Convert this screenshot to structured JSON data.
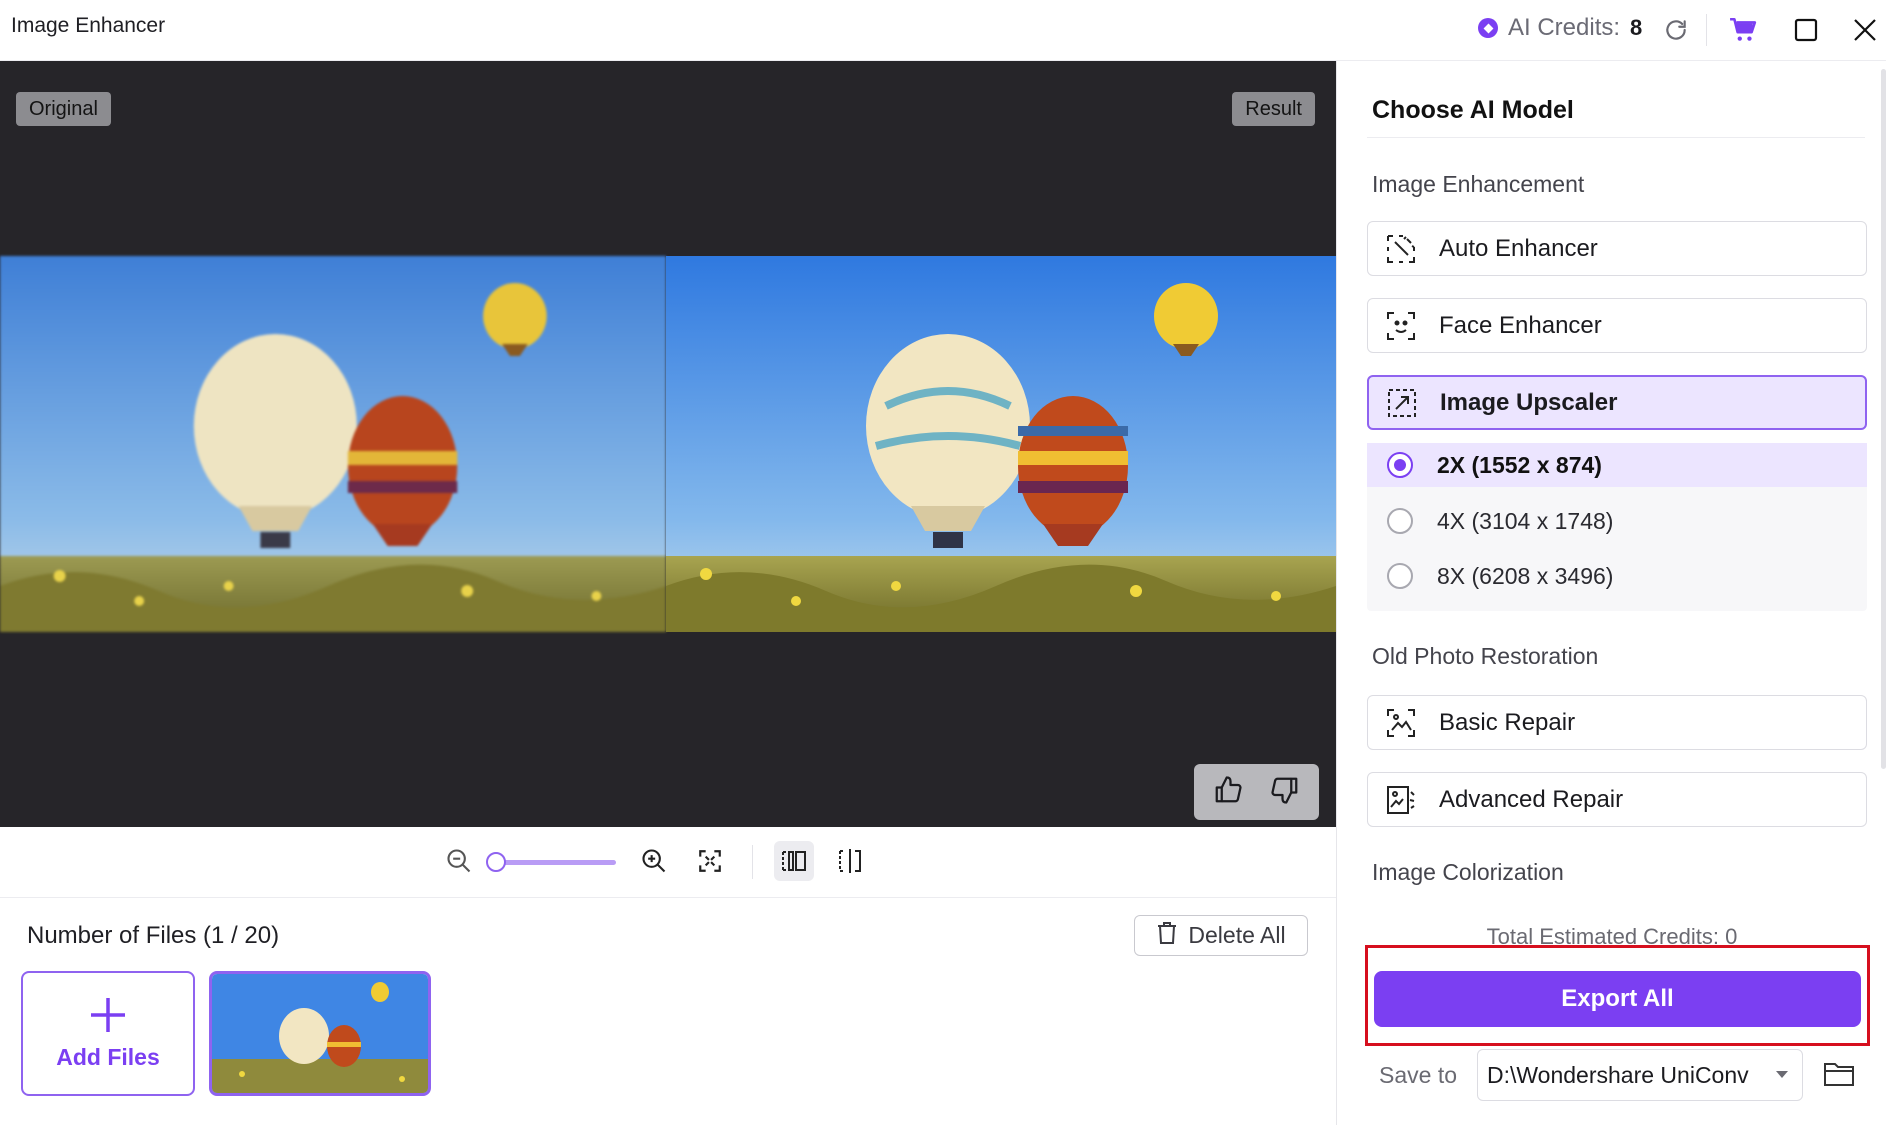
{
  "app": {
    "title": "Image Enhancer"
  },
  "credits": {
    "label": "AI Credits:",
    "value": "8"
  },
  "preview": {
    "original_label": "Original",
    "result_label": "Result"
  },
  "files": {
    "count_label": "Number of Files (1 / 20)",
    "delete_all": "Delete All",
    "add_files": "Add Files"
  },
  "panel": {
    "title": "Choose AI Model",
    "sections": {
      "enhancement": "Image Enhancement",
      "restoration": "Old Photo Restoration",
      "colorization": "Image Colorization"
    },
    "models": {
      "auto": "Auto Enhancer",
      "face": "Face Enhancer",
      "upscaler": "Image Upscaler",
      "basic": "Basic Repair",
      "advanced": "Advanced Repair"
    },
    "upscale_options": [
      {
        "label": "2X (1552 x 874)",
        "selected": true
      },
      {
        "label": "4X (3104 x 1748)",
        "selected": false
      },
      {
        "label": "8X (6208 x 3496)",
        "selected": false
      }
    ],
    "total_credits": "Total Estimated Credits: 0",
    "export_all": "Export All",
    "save_to_label": "Save to",
    "save_path": "D:\\Wondershare UniConv"
  },
  "icons": {
    "credits": "gem-icon",
    "refresh": "refresh-icon",
    "cart": "cart-icon",
    "maximize": "maximize-icon",
    "close": "close-icon",
    "thumbs_up": "thumbs-up-icon",
    "thumbs_down": "thumbs-down-icon",
    "zoom_out": "zoom-out-icon",
    "zoom_in": "zoom-in-icon",
    "fit": "fit-screen-icon",
    "side_by_side": "side-by-side-view-icon",
    "split": "split-view-icon",
    "trash": "trash-icon",
    "plus": "plus-icon",
    "folder": "folder-icon"
  },
  "colors": {
    "accent": "#7b3ff2",
    "highlight": "#d60f1e",
    "preview_bg": "#262529"
  },
  "zoom": {
    "level": 0
  }
}
